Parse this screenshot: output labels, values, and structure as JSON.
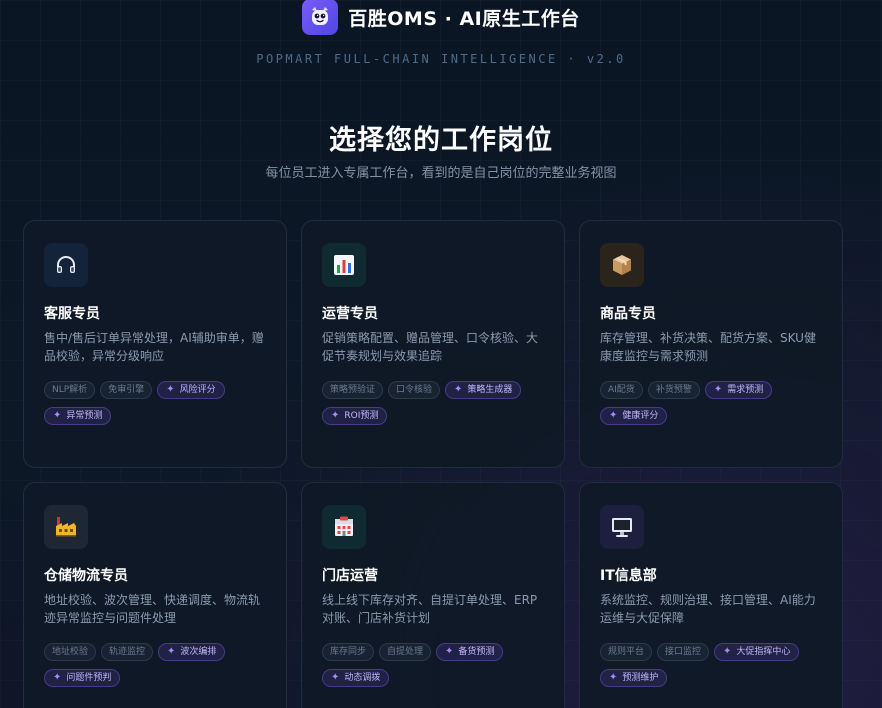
{
  "header": {
    "app_title": "百胜OMS · AI原生工作台",
    "tagline": "POPMART FULL-CHAIN INTELLIGENCE · v2.0",
    "logo_icon": "robot-mascot-icon"
  },
  "hero": {
    "title": "选择您的工作岗位",
    "subtitle": "每位员工进入专属工作台，看到的是自己岗位的完整业务视图"
  },
  "roles": [
    {
      "title": "客服专员",
      "desc": "售中/售后订单异常处理，AI辅助审单，赠品校验，异常分级响应",
      "icon": "headphones-icon",
      "icon_bg": "#13233a",
      "tags": [
        "NLP解析",
        "免审引擎"
      ],
      "ai_tags": [
        "风险评分",
        "异常预测"
      ]
    },
    {
      "title": "运营专员",
      "desc": "促销策略配置、赠品管理、口令核验、大促节奏规划与效果追踪",
      "icon": "bar-chart-icon",
      "icon_bg": "#102a32",
      "tags": [
        "策略预验证",
        "口令核验"
      ],
      "ai_tags": [
        "策略生成器",
        "ROI预测"
      ]
    },
    {
      "title": "商品专员",
      "desc": "库存管理、补货决策、配货方案、SKU健康度监控与需求预测",
      "icon": "package-box-icon",
      "icon_bg": "#2a241d",
      "tags": [
        "AI配货",
        "补货预警"
      ],
      "ai_tags": [
        "需求预测",
        "健康评分"
      ]
    },
    {
      "title": "仓储物流专员",
      "desc": "地址校验、波次管理、快递调度、物流轨迹异常监控与问题件处理",
      "icon": "factory-icon",
      "icon_bg": "#1e2733",
      "tags": [
        "地址校验",
        "轨迹监控"
      ],
      "ai_tags": [
        "波次编排",
        "问题件预判"
      ]
    },
    {
      "title": "门店运营",
      "desc": "线上线下库存对齐、自提订单处理、ERP对账、门店补货计划",
      "icon": "store-icon",
      "icon_bg": "#102a32",
      "tags": [
        "库存同步",
        "自提处理"
      ],
      "ai_tags": [
        "备货预测",
        "动态调拨"
      ]
    },
    {
      "title": "IT信息部",
      "desc": "系统监控、规则治理、接口管理、AI能力运维与大促保障",
      "icon": "monitor-icon",
      "icon_bg": "#1c1f3e",
      "tags": [
        "规则平台",
        "接口监控"
      ],
      "ai_tags": [
        "大促指挥中心",
        "预测维护"
      ]
    }
  ]
}
